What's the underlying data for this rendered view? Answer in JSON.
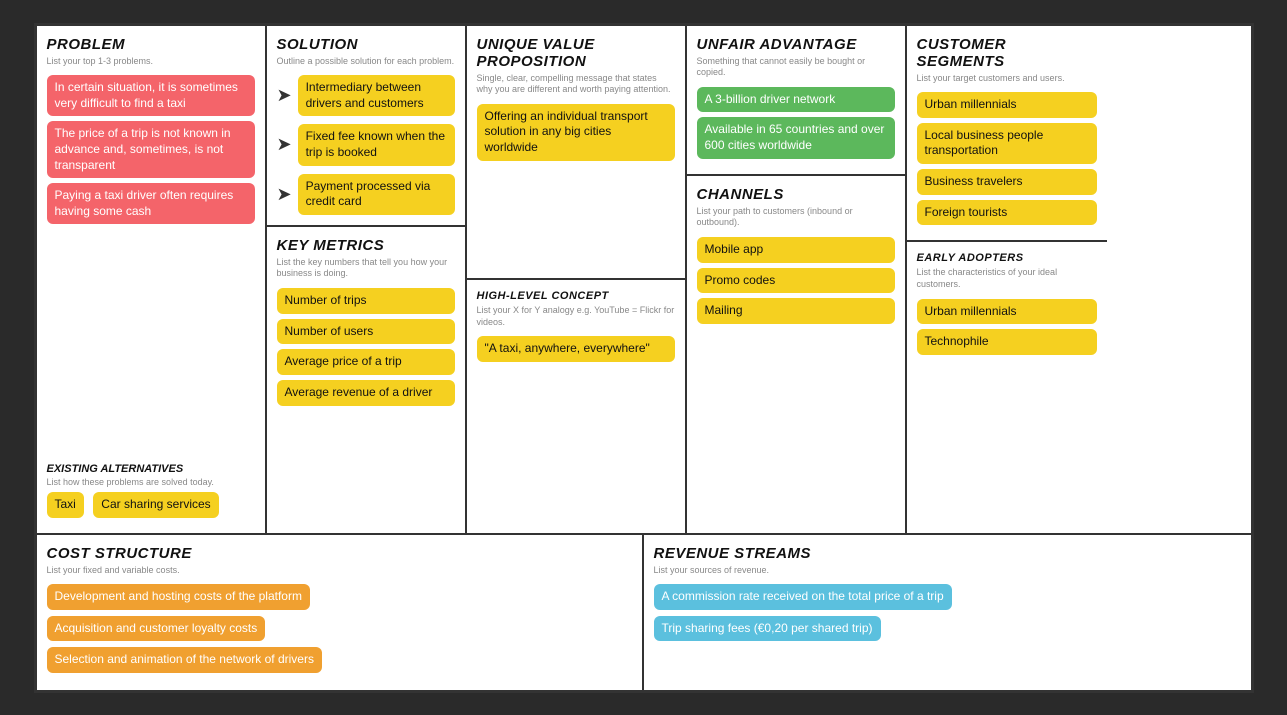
{
  "colors": {
    "red": "#f4646a",
    "yellow": "#f5d020",
    "green": "#5cb85c",
    "cyan": "#5bc0de",
    "orange": "#f0a030",
    "bg": "#2a2a2a",
    "border": "#333"
  },
  "problem": {
    "title": "PROBLEM",
    "subtitle": "List your top 1-3 problems.",
    "items": [
      "In certain situation, it is sometimes very difficult to find a taxi",
      "The price of a trip is not known in advance and, sometimes, is not transparent",
      "Paying a taxi driver often requires having some cash"
    ],
    "existing_alt_title": "EXISTING ALTERNATIVES",
    "existing_alt_subtitle": "List how these problems are solved today.",
    "alternatives": [
      "Taxi",
      "Car sharing services"
    ]
  },
  "solution": {
    "title": "SOLUTION",
    "subtitle": "Outline a possible solution for each problem.",
    "items": [
      "Intermediary between drivers and customers",
      "Fixed fee known when the trip is booked",
      "Payment processed via credit card"
    ]
  },
  "key_metrics": {
    "title": "KEY METRICS",
    "subtitle": "List the key numbers that tell you how your business is doing.",
    "items": [
      "Number of trips",
      "Number of users",
      "Average price of a trip",
      "Average revenue of a driver"
    ]
  },
  "uvp": {
    "title": "UNIQUE VALUE PROPOSITION",
    "subtitle": "Single, clear, compelling message that states why you are different and worth paying attention.",
    "main_text": "Offering an individual transport solution in any big cities worldwide",
    "high_level_title": "HIGH-LEVEL CONCEPT",
    "high_level_subtitle": "List your X for Y analogy e.g. YouTube = Flickr for videos.",
    "high_level_text": "\"A taxi, anywhere, everywhere\""
  },
  "unfair_advantage": {
    "title": "UNFAIR ADVANTAGE",
    "subtitle": "Something that cannot easily be bought or copied.",
    "items": [
      "A 3-billion driver network",
      "Available in 65 countries and over 600 cities worldwide"
    ]
  },
  "channels": {
    "title": "CHANNELS",
    "subtitle": "List your path to customers (inbound or outbound).",
    "items": [
      "Mobile app",
      "Promo codes",
      "Mailing"
    ]
  },
  "customer_segments": {
    "title": "CUSTOMER SEGMENTS",
    "subtitle": "List your target customers and users.",
    "items": [
      "Urban millennials",
      "Local business people transportation",
      "Business travelers",
      "Foreign tourists"
    ]
  },
  "early_adopters": {
    "title": "EARLY ADOPTERS",
    "subtitle": "List the characteristics of your ideal customers.",
    "items": [
      "Urban millennials",
      "Technophile"
    ]
  },
  "cost_structure": {
    "title": "COST STRUCTURE",
    "subtitle": "List your fixed and variable costs.",
    "items": [
      "Development and hosting costs of the platform",
      "Acquisition and customer loyalty costs",
      "Selection and animation of the network of drivers"
    ]
  },
  "revenue_streams": {
    "title": "REVENUE STREAMS",
    "subtitle": "List your sources of revenue.",
    "items": [
      "A commission rate received on the total price of a trip",
      "Trip sharing fees (€0,20 per shared trip)"
    ]
  }
}
